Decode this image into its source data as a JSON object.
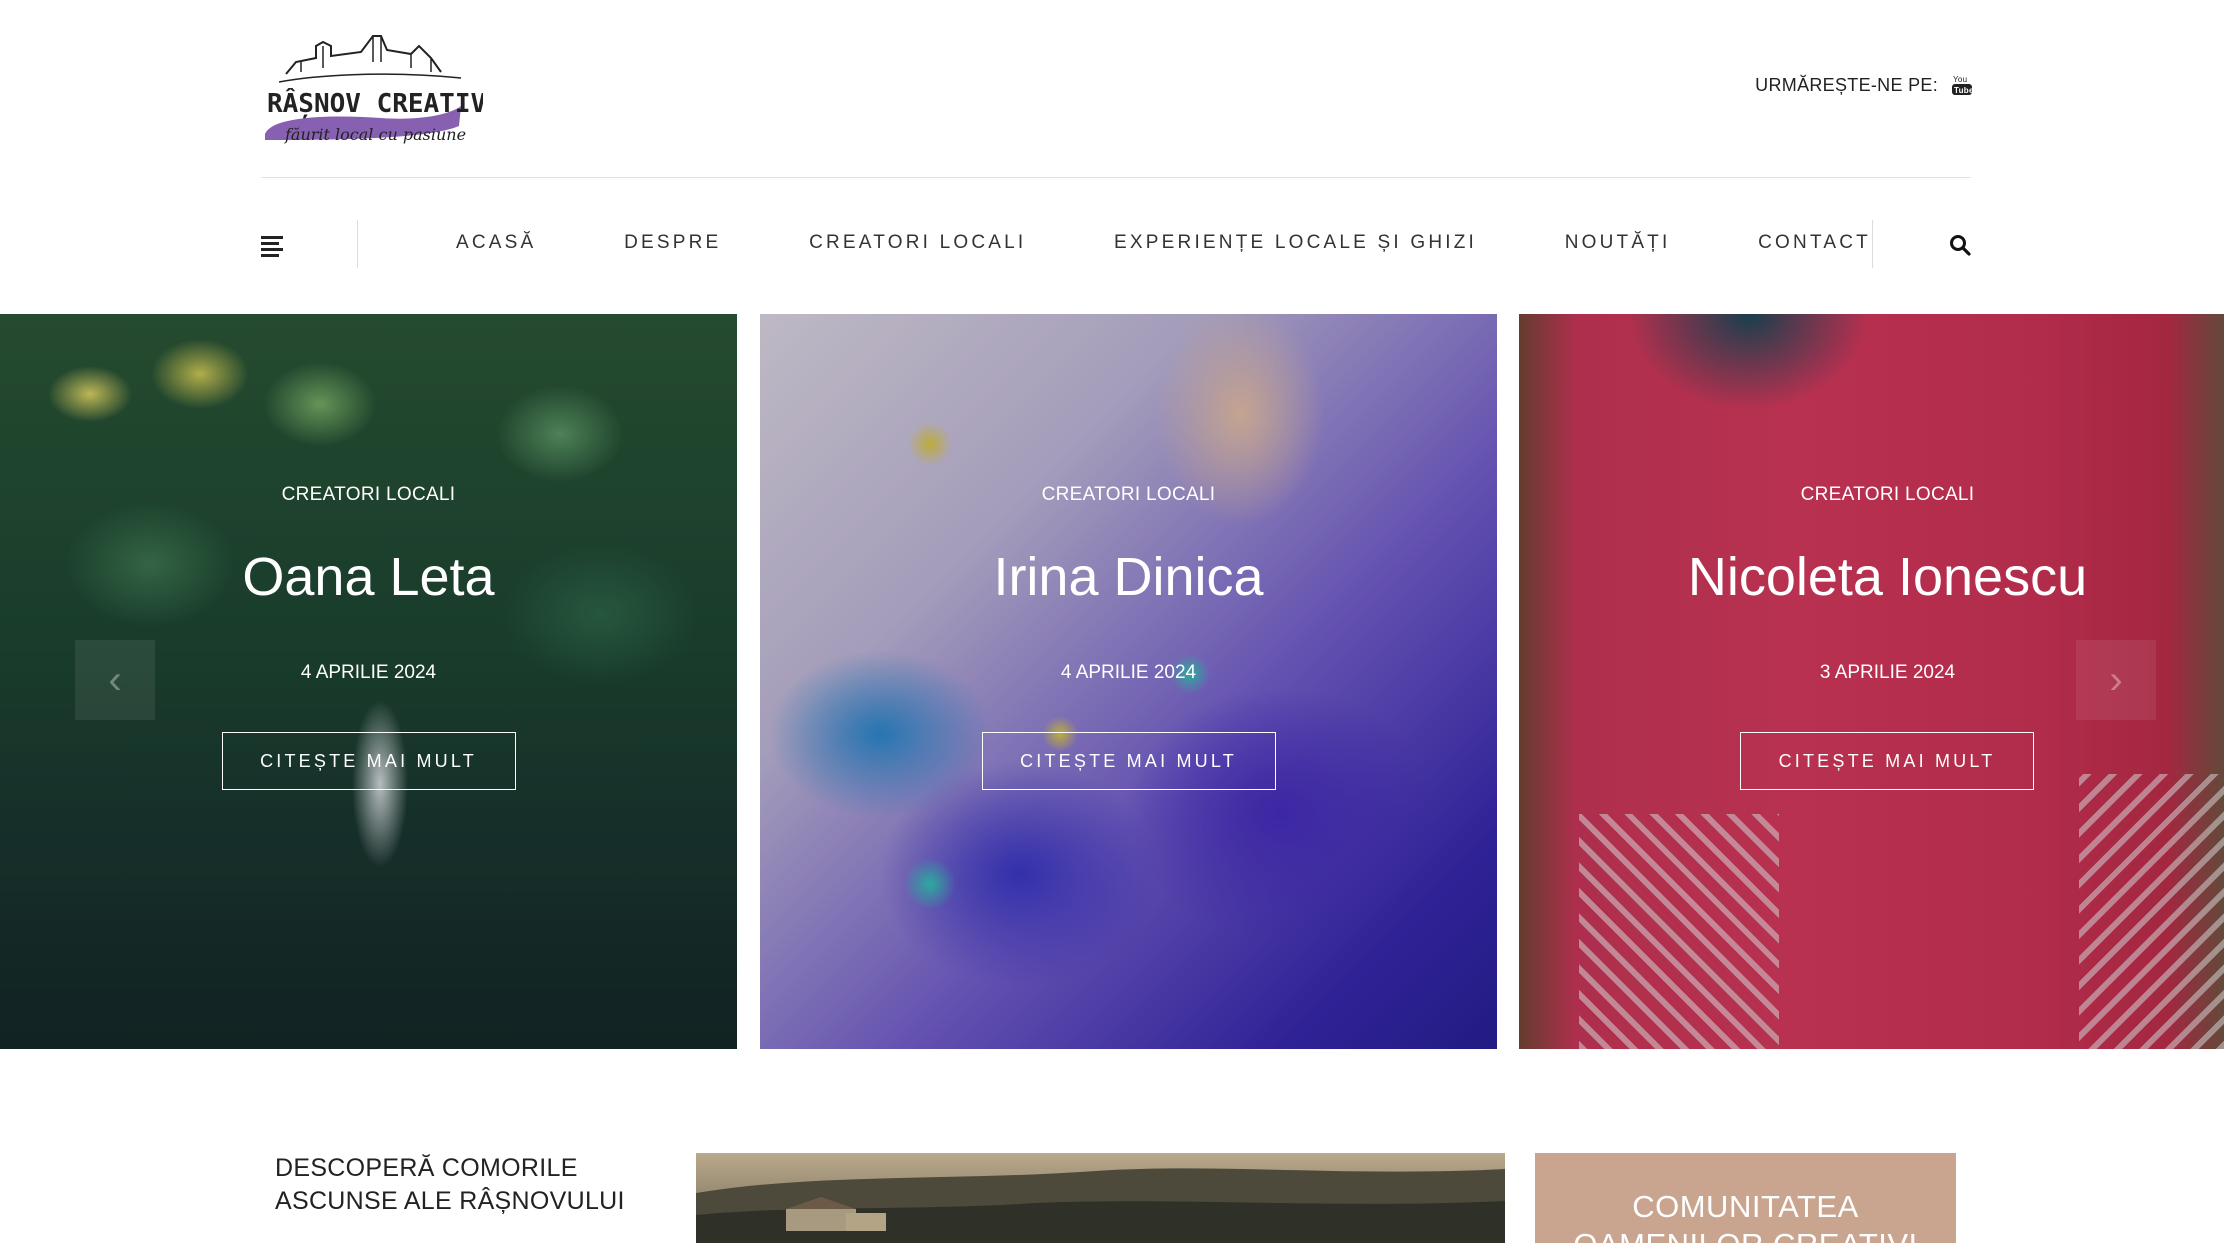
{
  "header": {
    "logo": {
      "name": "RÂȘNOV CREATIV",
      "tagline": "făurit local cu pasiune"
    },
    "follow_label": "URMĂREȘTE-NE PE:",
    "social_icon": "youtube-icon"
  },
  "nav": {
    "menu_icon": "hamburger-menu-icon",
    "items": [
      "ACASĂ",
      "DESPRE",
      "CREATORI LOCALI",
      "EXPERIENȚE LOCALE ȘI GHIZI",
      "NOUTĂȚI",
      "CONTACT"
    ],
    "search_icon": "search-icon"
  },
  "slider": {
    "prev_icon": "chevron-left-icon",
    "next_icon": "chevron-right-icon",
    "slides": [
      {
        "category": "CREATORI LOCALI",
        "title": "Oana Leta",
        "date": "4 APRILIE 2024",
        "button": "CITEȘTE MAI MULT"
      },
      {
        "category": "CREATORI LOCALI",
        "title": "Irina Dinica",
        "date": "4 APRILIE 2024",
        "button": "CITEȘTE MAI MULT"
      },
      {
        "category": "CREATORI LOCALI",
        "title": "Nicoleta Ionescu",
        "date": "3 APRILIE 2024",
        "button": "CITEȘTE MAI MULT"
      }
    ]
  },
  "intro": {
    "line1": "DESCOPERĂ COMORILE",
    "line2": "ASCUNSE ALE RÂȘNOVULUI"
  },
  "community": {
    "line1": "COMUNITATEA",
    "line2": "OAMENILOR CREATIVI"
  },
  "colors": {
    "accent_purple": "#7b4fa8",
    "community_bg": "#c9a48f"
  }
}
